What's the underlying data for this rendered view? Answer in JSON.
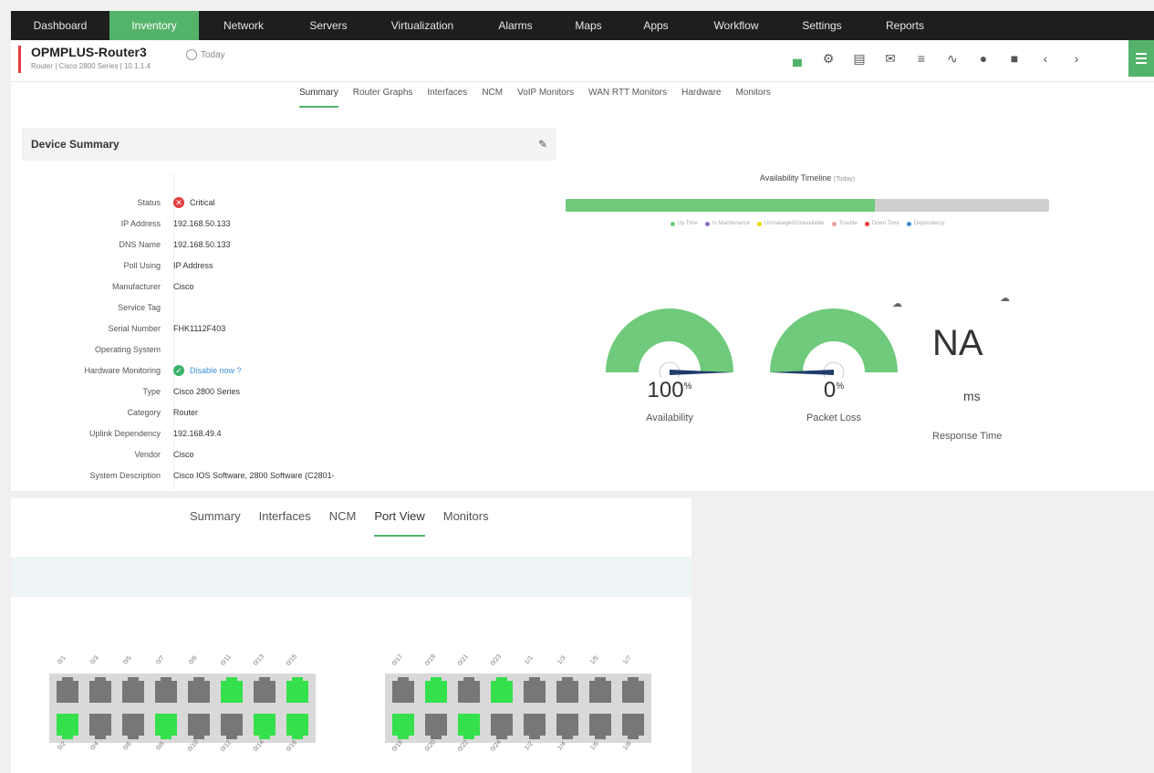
{
  "topnav": {
    "items": [
      {
        "label": "Dashboard",
        "w": 108
      },
      {
        "label": "Inventory",
        "w": 98,
        "active": true
      },
      {
        "label": "Network",
        "w": 98
      },
      {
        "label": "Servers",
        "w": 88
      },
      {
        "label": "Virtualization",
        "w": 118
      },
      {
        "label": "Alarms",
        "w": 86
      },
      {
        "label": "Maps",
        "w": 74
      },
      {
        "label": "Apps",
        "w": 74
      },
      {
        "label": "Workflow",
        "w": 102
      },
      {
        "label": "Settings",
        "w": 86
      },
      {
        "label": "Reports",
        "w": 96
      }
    ]
  },
  "device": {
    "name": "OPMPLUS-Router3",
    "subtitle": "Router | Cisco 2800 Series | 10.1.1.4",
    "time": "Today"
  },
  "toolbar": [
    "chart-icon",
    "gear-icon",
    "device-icon",
    "mail-icon",
    "link-icon",
    "graph-icon",
    "globe-icon",
    "monitor-icon",
    "chevron-left-icon",
    "chevron-right-icon"
  ],
  "tabs_top": [
    "Summary",
    "Router Graphs",
    "Interfaces",
    "NCM",
    "VoIP Monitors",
    "WAN RTT Monitors",
    "Hardware",
    "Monitors"
  ],
  "tabs_top_active": 0,
  "summary": {
    "title": "Device Summary",
    "rows": [
      {
        "k": "Status",
        "v": "Critical",
        "icon": "critical"
      },
      {
        "k": "IP Address",
        "v": "192.168.50.133"
      },
      {
        "k": "DNS Name",
        "v": "192.168.50.133"
      },
      {
        "k": "Poll Using",
        "v": "IP Address"
      },
      {
        "k": "Manufacturer",
        "v": "Cisco"
      },
      {
        "k": "Service Tag",
        "v": ""
      },
      {
        "k": "Serial Number",
        "v": "FHK1112F403"
      },
      {
        "k": "Operating System",
        "v": ""
      },
      {
        "k": "Hardware Monitoring",
        "v": "Disable now ?",
        "icon": "ok"
      },
      {
        "k": "Type",
        "v": "Cisco 2800 Series"
      },
      {
        "k": "Category",
        "v": "Router"
      },
      {
        "k": "Uplink Dependency",
        "v": "192.168.49.4"
      },
      {
        "k": "Vendor",
        "v": "Cisco"
      },
      {
        "k": "System Description",
        "v": "Cisco IOS Software, 2800 Software (C2801-"
      }
    ]
  },
  "availability": {
    "title": "Availability Timeline",
    "title_note": "(Today)",
    "up_fraction": 0.64,
    "legend": [
      {
        "label": "Up Time",
        "color": "#6fca7b"
      },
      {
        "label": "In Maintenance",
        "color": "#8e6fca"
      },
      {
        "label": "Unmanaged/Unavailable",
        "color": "#e6d800"
      },
      {
        "label": "Trouble",
        "color": "#f0a0a0"
      },
      {
        "label": "Down Time",
        "color": "#e03d3d"
      },
      {
        "label": "Dependency",
        "color": "#3a8fd8"
      }
    ]
  },
  "gauges": {
    "availability": {
      "value": "100",
      "unit": "%",
      "label": "Availability"
    },
    "packet_loss": {
      "value": "0",
      "unit": "%",
      "label": "Packet Loss"
    },
    "response": {
      "value": "NA",
      "unit": "ms",
      "label": "Response Time"
    }
  },
  "tabs_bottom": [
    "Summary",
    "Interfaces",
    "NCM",
    "Port View",
    "Monitors"
  ],
  "tabs_bottom_active": 3,
  "switch1": {
    "top_labels": [
      "0/1",
      "0/3",
      "0/5",
      "0/7",
      "0/9",
      "0/11",
      "0/13",
      "0/15"
    ],
    "bottom_labels": [
      "0/2",
      "0/4",
      "0/6",
      "0/8",
      "0/10",
      "0/12",
      "0/14",
      "0/16"
    ],
    "top_up": [
      false,
      false,
      false,
      false,
      false,
      true,
      false,
      true
    ],
    "bottom_up": [
      true,
      false,
      false,
      true,
      false,
      false,
      true,
      true
    ]
  },
  "switch2": {
    "top_labels": [
      "0/17",
      "0/19",
      "0/21",
      "0/23",
      "1/1",
      "1/3",
      "1/5",
      "1/7"
    ],
    "bottom_labels": [
      "0/18",
      "0/20",
      "0/22",
      "0/24",
      "1/2",
      "1/4",
      "1/6",
      "1/8"
    ],
    "top_up": [
      false,
      true,
      false,
      true,
      false,
      false,
      false,
      false
    ],
    "bottom_up": [
      true,
      false,
      true,
      false,
      false,
      false,
      false,
      false
    ]
  }
}
